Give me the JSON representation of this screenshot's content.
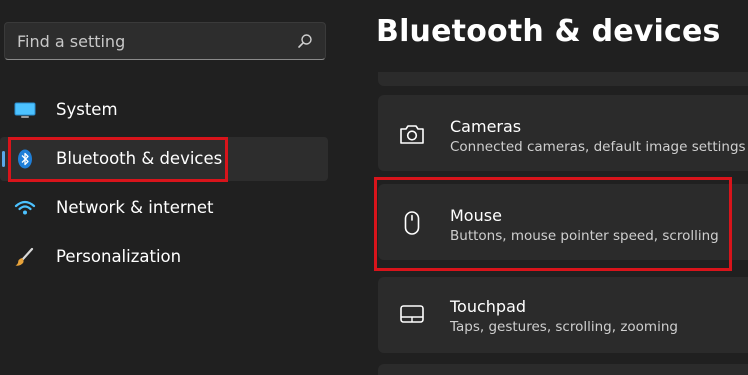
{
  "search": {
    "placeholder": "Find a setting"
  },
  "sidebar": {
    "items": [
      {
        "label": "System",
        "icon": "monitor-icon",
        "selected": false
      },
      {
        "label": "Bluetooth & devices",
        "icon": "bluetooth-icon",
        "selected": true
      },
      {
        "label": "Network & internet",
        "icon": "wifi-icon",
        "selected": false
      },
      {
        "label": "Personalization",
        "icon": "paintbrush-icon",
        "selected": false
      }
    ]
  },
  "main": {
    "title": "Bluetooth & devices",
    "cards": [
      {
        "title": "Cameras",
        "subtitle": "Connected cameras, default image settings",
        "icon": "camera-icon"
      },
      {
        "title": "Mouse",
        "subtitle": "Buttons, mouse pointer speed, scrolling",
        "icon": "mouse-icon"
      },
      {
        "title": "Touchpad",
        "subtitle": "Taps, gestures, scrolling, zooming",
        "icon": "touchpad-icon"
      }
    ]
  },
  "colors": {
    "background": "#202020",
    "card": "#2b2b2b",
    "accent": "#5aa8e8",
    "highlight": "#d8141b"
  }
}
